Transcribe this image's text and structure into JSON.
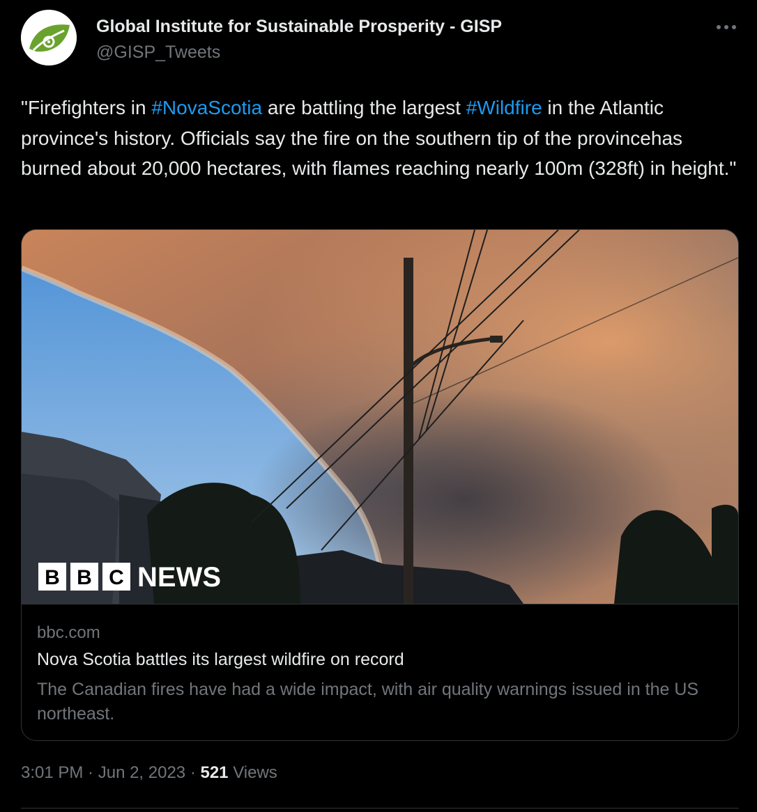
{
  "account": {
    "display_name": "Global Institute for Sustainable Prosperity - GISP",
    "handle": "@GISP_Tweets",
    "avatar_icon": "gisp-leaf-logo-icon",
    "brand_color": "#6aa22e"
  },
  "more_icon": "more-horizontal-icon",
  "tweet": {
    "text_1": "\"Firefighters in ",
    "hashtag_1": "#NovaScotia",
    "text_2": " are battling the largest ",
    "hashtag_2": "#Wildfire",
    "text_3": " in the Atlantic province's history. Officials say the fire on the southern tip of the provincehas burned about 20,000 hectares, with flames reaching nearly 100m (328ft) in height.\"",
    "link_color": "#1d9bf0"
  },
  "card": {
    "image_description_icon": "wildfire-smoke-photo",
    "logo_letters": [
      "B",
      "B",
      "C"
    ],
    "logo_word": "NEWS",
    "domain": "bbc.com",
    "title": "Nova Scotia battles its largest wildfire on record",
    "description": "The Canadian fires have had a wide impact, with air quality warnings issued in the US northeast."
  },
  "meta": {
    "time": "3:01 PM",
    "separator_1": " · ",
    "date": "Jun 2, 2023",
    "separator_2": " · ",
    "views_count": "521",
    "views_label": " Views"
  }
}
